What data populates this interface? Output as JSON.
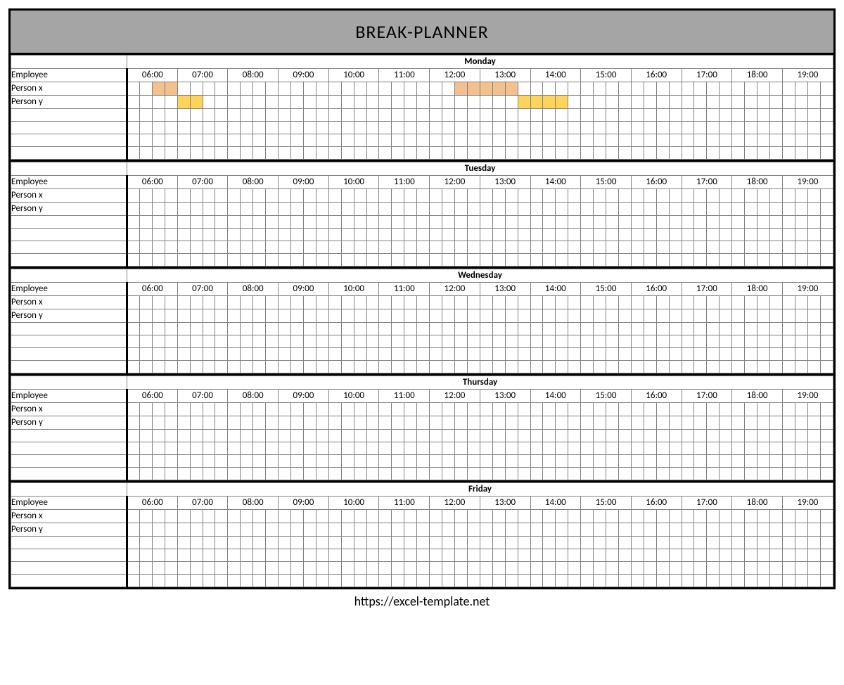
{
  "title": "BREAK-PLANNER",
  "footer": "https://excel-template.net",
  "slots_per_hour": 4,
  "hours": [
    "06:00",
    "07:00",
    "08:00",
    "09:00",
    "10:00",
    "11:00",
    "12:00",
    "13:00",
    "14:00",
    "15:00",
    "16:00",
    "17:00",
    "18:00",
    "19:00"
  ],
  "employee_header": "Employee",
  "row_labels": [
    "Person x",
    "Person y",
    "",
    "",
    "",
    ""
  ],
  "days": [
    {
      "name": "Monday",
      "rows": [
        {
          "fills": [
            {
              "start": 2,
              "end": 4,
              "color": "orange"
            },
            {
              "start": 26,
              "end": 31,
              "color": "orange"
            }
          ]
        },
        {
          "fills": [
            {
              "start": 4,
              "end": 6,
              "color": "yellow"
            },
            {
              "start": 31,
              "end": 35,
              "color": "yellow"
            }
          ]
        },
        {
          "fills": []
        },
        {
          "fills": []
        },
        {
          "fills": []
        },
        {
          "fills": []
        }
      ]
    },
    {
      "name": "Tuesday",
      "rows": [
        {
          "fills": []
        },
        {
          "fills": []
        },
        {
          "fills": []
        },
        {
          "fills": []
        },
        {
          "fills": []
        },
        {
          "fills": []
        }
      ]
    },
    {
      "name": "Wednesday",
      "rows": [
        {
          "fills": []
        },
        {
          "fills": []
        },
        {
          "fills": []
        },
        {
          "fills": []
        },
        {
          "fills": []
        },
        {
          "fills": []
        }
      ]
    },
    {
      "name": "Thursday",
      "rows": [
        {
          "fills": []
        },
        {
          "fills": []
        },
        {
          "fills": []
        },
        {
          "fills": []
        },
        {
          "fills": []
        },
        {
          "fills": []
        }
      ]
    },
    {
      "name": "Friday",
      "rows": [
        {
          "fills": []
        },
        {
          "fills": []
        },
        {
          "fills": []
        },
        {
          "fills": []
        },
        {
          "fills": []
        },
        {
          "fills": []
        }
      ]
    }
  ]
}
